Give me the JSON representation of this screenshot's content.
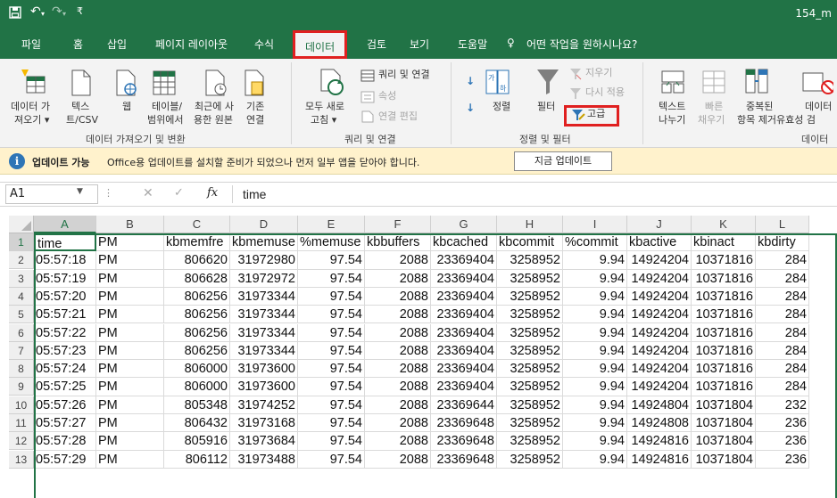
{
  "titlebar": {
    "save_icon": "save-icon",
    "undo_icon": "undo-icon",
    "redo_icon": "redo-icon",
    "customize_icon": "customize-quick-access-icon",
    "filename": "154_m"
  },
  "menu": {
    "tabs": [
      "파일",
      "홈",
      "삽입",
      "페이지 레이아웃",
      "수식",
      "데이터",
      "검토",
      "보기",
      "도움말"
    ],
    "active_tab": "데이터",
    "search_icon": "lightbulb-icon",
    "search_text": "어떤 작업을 원하시나요?"
  },
  "ribbon": {
    "get_data": {
      "label1": "데이터 가",
      "label2": "져오기 ▾",
      "text_csv1": "텍스",
      "text_csv2": "트/CSV",
      "web": "웹",
      "table1": "테이블/",
      "table2": "범위에서",
      "recent1": "최근에 사",
      "recent2": "용한 원본",
      "existing1": "기존",
      "existing2": "연결",
      "group": "데이터 가져오기 및 변환"
    },
    "queries": {
      "refresh1": "모두 새로",
      "refresh2": "고침 ▾",
      "queries_connections": "쿼리 및 연결",
      "properties": "속성",
      "edit_links": "연결 편집",
      "group": "쿼리 및 연결"
    },
    "sort_filter": {
      "sort": "정렬",
      "filter": "필터",
      "clear": "지우기",
      "reapply": "다시 적용",
      "advanced": "고급",
      "group": "정렬 및 필터"
    },
    "data_tools": {
      "text_to_columns1": "텍스트",
      "text_to_columns2": "나누기",
      "flash_fill1": "빠른",
      "flash_fill2": "채우기",
      "remove_duplicates1": "중복된",
      "remove_duplicates2": "항목 제거",
      "validation1": "데이터",
      "validation2": "유효성 검",
      "group": "데이터"
    }
  },
  "notification": {
    "title": "업데이트 가능",
    "message": "Office용 업데이트를 설치할 준비가 되었으나 먼저 일부 앱을 닫아야 합니다.",
    "button": "지금 업데이트"
  },
  "formula_bar": {
    "name_box": "A1",
    "fx": "fx",
    "content": "time"
  },
  "sheet": {
    "columns": [
      "A",
      "B",
      "C",
      "D",
      "E",
      "F",
      "G",
      "H",
      "I",
      "J",
      "K",
      "L"
    ],
    "headers": [
      "time",
      "PM",
      "kbmemfre",
      "kbmemuse",
      "%memuse",
      "kbbuffers",
      "kbcached",
      "kbcommit",
      "%commit",
      "kbactive",
      "kbinact",
      "kbdirty"
    ],
    "row_numbers": [
      "1",
      "2",
      "3",
      "4",
      "5",
      "6",
      "7",
      "8",
      "9",
      "10",
      "11",
      "12",
      "13"
    ],
    "rows": [
      [
        "05:57:18",
        "PM",
        "806620",
        "31972980",
        "97.54",
        "2088",
        "23369404",
        "3258952",
        "9.94",
        "14924204",
        "10371816",
        "284"
      ],
      [
        "05:57:19",
        "PM",
        "806628",
        "31972972",
        "97.54",
        "2088",
        "23369404",
        "3258952",
        "9.94",
        "14924204",
        "10371816",
        "284"
      ],
      [
        "05:57:20",
        "PM",
        "806256",
        "31973344",
        "97.54",
        "2088",
        "23369404",
        "3258952",
        "9.94",
        "14924204",
        "10371816",
        "284"
      ],
      [
        "05:57:21",
        "PM",
        "806256",
        "31973344",
        "97.54",
        "2088",
        "23369404",
        "3258952",
        "9.94",
        "14924204",
        "10371816",
        "284"
      ],
      [
        "05:57:22",
        "PM",
        "806256",
        "31973344",
        "97.54",
        "2088",
        "23369404",
        "3258952",
        "9.94",
        "14924204",
        "10371816",
        "284"
      ],
      [
        "05:57:23",
        "PM",
        "806256",
        "31973344",
        "97.54",
        "2088",
        "23369404",
        "3258952",
        "9.94",
        "14924204",
        "10371816",
        "284"
      ],
      [
        "05:57:24",
        "PM",
        "806000",
        "31973600",
        "97.54",
        "2088",
        "23369404",
        "3258952",
        "9.94",
        "14924204",
        "10371816",
        "284"
      ],
      [
        "05:57:25",
        "PM",
        "806000",
        "31973600",
        "97.54",
        "2088",
        "23369404",
        "3258952",
        "9.94",
        "14924204",
        "10371816",
        "284"
      ],
      [
        "05:57:26",
        "PM",
        "805348",
        "31974252",
        "97.54",
        "2088",
        "23369644",
        "3258952",
        "9.94",
        "14924804",
        "10371804",
        "232"
      ],
      [
        "05:57:27",
        "PM",
        "806432",
        "31973168",
        "97.54",
        "2088",
        "23369648",
        "3258952",
        "9.94",
        "14924808",
        "10371804",
        "236"
      ],
      [
        "05:57:28",
        "PM",
        "805916",
        "31973684",
        "97.54",
        "2088",
        "23369648",
        "3258952",
        "9.94",
        "14924816",
        "10371804",
        "236"
      ],
      [
        "05:57:29",
        "PM",
        "806112",
        "31973488",
        "97.54",
        "2088",
        "23369648",
        "3258952",
        "9.94",
        "14924816",
        "10371804",
        "236"
      ]
    ]
  },
  "colors": {
    "excel_green": "#217346",
    "highlight_red": "#e02020",
    "notification_bg": "#fff2cc"
  }
}
